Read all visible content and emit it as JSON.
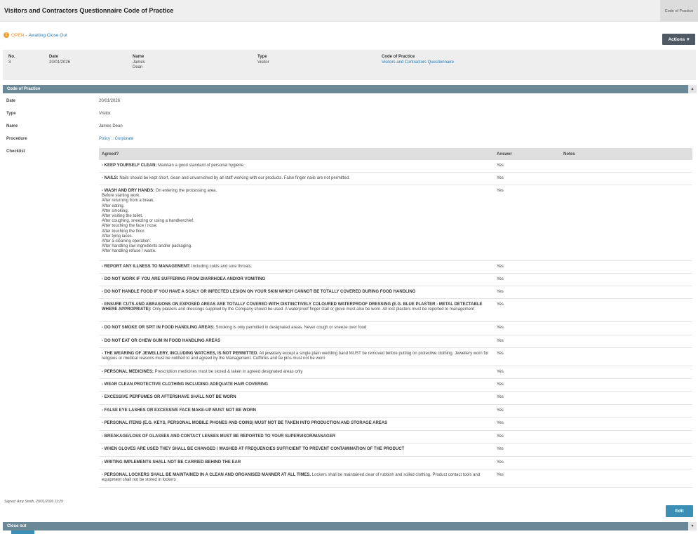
{
  "header": {
    "title": "Visitors and Contractors Questionnaire Code of Practice",
    "tab_label": "Code of Practice"
  },
  "status": {
    "icon": "info-icon",
    "state": "OPEN",
    "separator": "-",
    "detail": "Awaiting Close Out"
  },
  "actions": {
    "label": "Actions",
    "caret": "▾"
  },
  "summary": {
    "no_label": "No.",
    "no_value": "3",
    "date_label": "Date",
    "date_value": "20/01/2026",
    "name_label": "Name",
    "name_first": "James",
    "name_last": "Dean",
    "type_label": "Type",
    "type_value": "Visitor",
    "cop_label": "Code of Practice",
    "cop_value": "Visitors and Contractors Questionnaire"
  },
  "section": {
    "title": "Code of Practice",
    "collapse": "▴"
  },
  "fields": {
    "date_label": "Date",
    "date_value": "20/01/2026",
    "type_label": "Type",
    "type_value": "Visitor",
    "name_label": "Name",
    "name_value": "James Dean",
    "procedure_label": "Procedure",
    "procedure_value": "Policy :: Corporate",
    "checklist_label": "Checklist"
  },
  "checklist": {
    "headers": {
      "agreed": "Agreed?",
      "answer": "Answer",
      "notes": "Notes"
    },
    "rows": [
      {
        "bold": "- KEEP YOURSELF CLEAN:",
        "text": " Maintain a good standard of personal hygiene.",
        "answer": "Yes"
      },
      {
        "bold": "- NAILS:",
        "text": " Nails should be kept short, clean and unvarnished by all staff working with our products. False finger nails are not permitted.",
        "answer": "Yes"
      },
      {
        "bold": "- WASH AND DRY HANDS:",
        "text": " On entering the processing area.",
        "answer": "Yes",
        "lines": [
          "Before starting work.",
          "After returning from a break.",
          "After eating.",
          "After smoking.",
          "After visiting the toilet.",
          "After coughing, sneezing or using a handkerchief.",
          "After touching the face / nose.",
          "After touching the floor.",
          "After tying laces.",
          "After a cleaning operation.",
          "After handling raw ingredients and/or packaging.",
          "After handling refuse / waste."
        ]
      },
      {
        "bold": "- REPORT ANY ILLNESS TO MANAGEMENT:",
        "text": " Including colds and sore throats.",
        "answer": "Yes"
      },
      {
        "bold": "- DO NOT WORK IF YOU ARE SUFFERING FROM DIARRHOEA AND/OR VOMITING",
        "text": "",
        "answer": "Yes"
      },
      {
        "bold": "- DO NOT HANDLE FOOD IF YOU HAVE A SCALY OR INFECTED LESION ON YOUR SKIN WHICH CANNOT BE TOTALLY COVERED DURING FOOD HANDLING",
        "text": "",
        "answer": "Yes"
      },
      {
        "bold": "- ENSURE CUTS AND ABRASIONS ON EXPOSED AREAS ARE TOTALLY COVERED WITH DISTINCTIVELY COLOURED WATERPROOF DRESSING (E.G. BLUE PLASTER - METAL DETECTABLE WHERE APPROPRIATE):",
        "text": " Only plasters and dressings supplied by the Company should be used. A waterproof finger stall or glove must also be worn. All lost plasters must be reported to management",
        "answer": "Yes"
      },
      {
        "bold": "- DO NOT SMOKE OR SPIT IN FOOD HANDLING AREAS:",
        "text": " Smoking is only permitted in designated areas. Never cough or sneeze over food",
        "answer": "Yes"
      },
      {
        "bold": "- DO NOT EAT OR CHEW GUM IN FOOD HANDLING AREAS",
        "text": "",
        "answer": "Yes"
      },
      {
        "bold": "- THE WEARING OF JEWELLERY, INCLUDING WATCHES, IS NOT PERMITTED.",
        "text": " All jewellery except a single plain wedding band MUST be removed before putting on protective clothing. Jewellery worn for religious or medical reasons must be notified to and agreed by the Management. Cufflinks and tie pins must not be worn",
        "answer": "Yes"
      },
      {
        "bold": "- PERSONAL MEDICINES:",
        "text": " Prescription medicines must be stored & taken in agreed designated areas only",
        "answer": "Yes"
      },
      {
        "bold": "- WEAR CLEAN PROTECTIVE CLOTHING INCLUDING ADEQUATE HAIR COVERING",
        "text": "",
        "answer": "Yes"
      },
      {
        "bold": "- EXCESSIVE PERFUMES OR AFTERSHAVE SHALL NOT BE WORN",
        "text": "",
        "answer": "Yes"
      },
      {
        "bold": "- FALSE EYE LASHES OR EXCESSIVE FACE MAKE-UP MUST NOT BE WORN",
        "text": "",
        "answer": "Yes"
      },
      {
        "bold": "- PERSONAL ITEMS (E.G. KEYS, PERSONAL MOBILE PHONES AND COINS) MUST NOT BE TAKEN INTO PRODUCTION AND STORAGE AREAS",
        "text": "",
        "answer": "Yes"
      },
      {
        "bold": "- BREAKAGE/LOSS OF GLASSES AND CONTACT LENSES MUST BE REPORTED TO YOUR SUPERVISOR/MANAGER",
        "text": "",
        "answer": "Yes"
      },
      {
        "bold": "- WHEN GLOVES ARE USED THEY SHALL BE CHANGED / WASHED AT FREQUENCIES SUFFICIENT TO PREVENT CONTAMINATION OF THE PRODUCT",
        "text": "",
        "answer": "Yes"
      },
      {
        "bold": "- WRITING IMPLEMENTS SHALL NOT BE CARRIED BEHIND THE EAR",
        "text": "",
        "answer": "Yes"
      },
      {
        "bold": "- PERSONAL LOCKERS SHALL BE MAINTAINED IN A CLEAN AND ORGANISED MANNER AT ALL TIMES.",
        "text": " Lockers shall be maintained clear of rubbish and soiled clothing. Product contact tools and equipment shall not be stored in lockers",
        "answer": "Yes"
      }
    ]
  },
  "footer": {
    "signed": "Signed: Amy Smith, 20/01/2026 11:29",
    "edit_label": "Edit"
  },
  "closeout": {
    "title": "Close out",
    "collapse": "▾"
  }
}
